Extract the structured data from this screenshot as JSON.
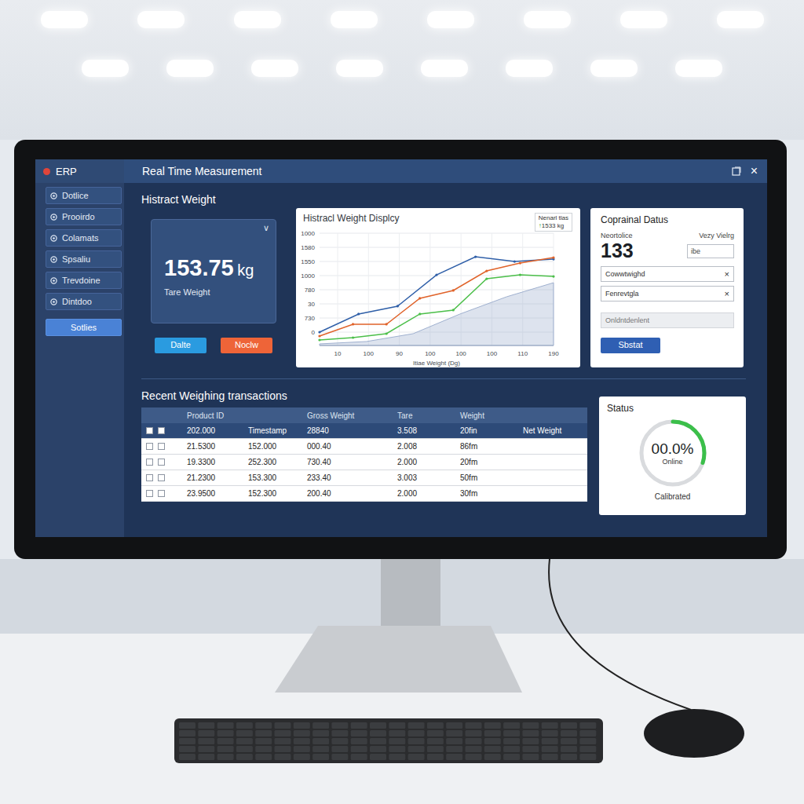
{
  "app": {
    "name": "ERP",
    "title": "Real Time Measurement",
    "close": "×"
  },
  "sidebar": {
    "items": [
      {
        "label": "Dotlice",
        "selected": false
      },
      {
        "label": "Prooirdo",
        "selected": false
      },
      {
        "label": "Colamats",
        "selected": false
      },
      {
        "label": "Spsaliu",
        "selected": false
      },
      {
        "label": "Trevdoine",
        "selected": false
      },
      {
        "label": "Dintdoo",
        "selected": false
      },
      {
        "label": "Sotlies",
        "selected": true
      }
    ]
  },
  "weight": {
    "heading": "Histract Weight",
    "value": "153.75",
    "unit": "kg",
    "label": "Tare Weight",
    "chevron": "∨",
    "buttons": [
      {
        "label": "Dalte",
        "color": "#2a9be0"
      },
      {
        "label": "Noclw",
        "color": "#ee6438"
      }
    ]
  },
  "chart": {
    "title": "Histracl Weight Displcy",
    "legend": {
      "label": "Nenarl tlas",
      "arrow": "↑",
      "value": "1533 kg"
    },
    "y_ticks": [
      "1000",
      "1580",
      "1550",
      "1000",
      "780",
      "30",
      "730",
      "0"
    ],
    "x_ticks": [
      "10",
      "100",
      "90",
      "100",
      "100",
      "100",
      "110",
      "190"
    ],
    "x_title": "Itiae Weight (Dg)",
    "series": [
      {
        "kind": "area",
        "color": "#9fb0cf",
        "values": [
          14,
          35,
          105,
          280,
          434,
          559
        ]
      },
      {
        "kind": "line",
        "color": "#2f5fa8",
        "values": [
          119,
          280,
          350,
          629,
          790,
          748,
          769
        ]
      },
      {
        "kind": "line",
        "color": "#e0632a",
        "values": [
          84,
          189,
          189,
          420,
          490,
          664,
          734,
          783
        ]
      },
      {
        "kind": "line",
        "color": "#4cbf4a",
        "values": [
          49,
          70,
          105,
          280,
          315,
          594,
          629,
          615
        ]
      }
    ]
  },
  "details": {
    "title": "Coprainal Datus",
    "left_label": "Neortolice",
    "right_label": "Vezy Vielrg",
    "number": "133",
    "small_field": "ibe",
    "fields": [
      {
        "value": "Cowwtwighd",
        "clear": "×"
      },
      {
        "value": "Fenrevtgla",
        "clear": "×"
      }
    ],
    "placeholder": "Onldntdenlent",
    "button": "Sbstat"
  },
  "table": {
    "title": "Recent Weighing transactions",
    "columns": [
      "Product ID",
      "",
      "Gross Weight",
      "Tare",
      "Weight",
      ""
    ],
    "rows": [
      {
        "selected": true,
        "cells": [
          "202.000",
          "Timestamp",
          "28840",
          "3.508",
          "20fin",
          "Net Weight"
        ]
      },
      {
        "selected": false,
        "cells": [
          "21.5300",
          "152.000",
          "000.40",
          "2.008",
          "86fm",
          ""
        ]
      },
      {
        "selected": false,
        "cells": [
          "19.3300",
          "252.300",
          "730.40",
          "2.000",
          "20fm",
          ""
        ]
      },
      {
        "selected": false,
        "cells": [
          "21.2300",
          "153.300",
          "233.40",
          "3.003",
          "50fm",
          ""
        ]
      },
      {
        "selected": false,
        "cells": [
          "23.9500",
          "152.300",
          "200.40",
          "2.000",
          "30fm",
          ""
        ]
      }
    ]
  },
  "status": {
    "title": "Status",
    "percent": "00.0%",
    "state": "Online",
    "note": "Calibrated",
    "level": 0.3
  }
}
